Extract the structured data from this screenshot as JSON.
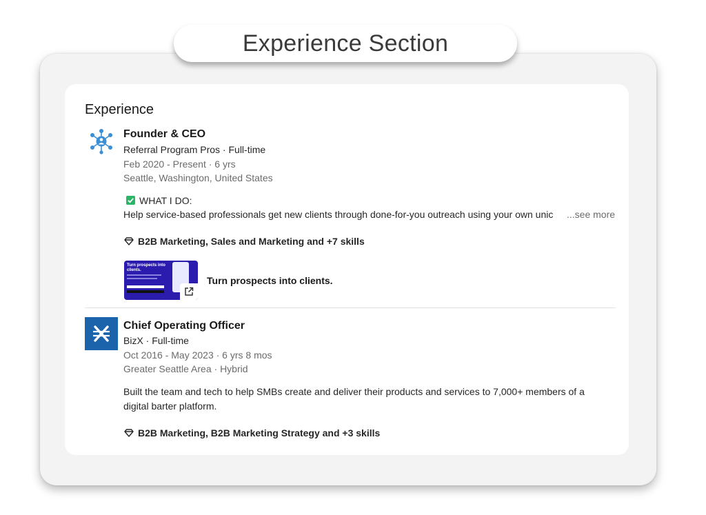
{
  "banner": {
    "title": "Experience Section"
  },
  "experience": {
    "heading": "Experience",
    "items": [
      {
        "title": "Founder & CEO",
        "company": "Referral Program Pros · Full-time",
        "dates": "Feb 2020 - Present · 6 yrs",
        "location": "Seattle, Washington, United States",
        "highlight_label": "WHAT I DO:",
        "description": "Help service-based professionals get new clients through done-for-you outreach using your own unic",
        "see_more": "...see more",
        "skills": "B2B Marketing, Sales and Marketing and +7 skills",
        "media": {
          "thumbnail_text": "Turn prospects into clients.",
          "title": "Turn prospects into clients."
        },
        "logo_icon": "network-people-icon"
      },
      {
        "title": "Chief Operating Officer",
        "company": "BizX · Full-time",
        "dates": "Oct 2016 - May 2023 · 6 yrs 8 mos",
        "location": "Greater Seattle Area · Hybrid",
        "description_line1": "Built the team and tech to help SMBs create and deliver their products and services to 7,000+ members of a",
        "description_line2": "digital barter platform.",
        "skills": "B2B Marketing, B2B Marketing Strategy and +3 skills",
        "logo_icon": "bizx-logo-icon"
      }
    ]
  },
  "colors": {
    "bizx_blue": "#1b64ac",
    "media_purple": "#2c1cae",
    "check_green": "#2bb566",
    "network_blue": "#3a8fd6"
  }
}
